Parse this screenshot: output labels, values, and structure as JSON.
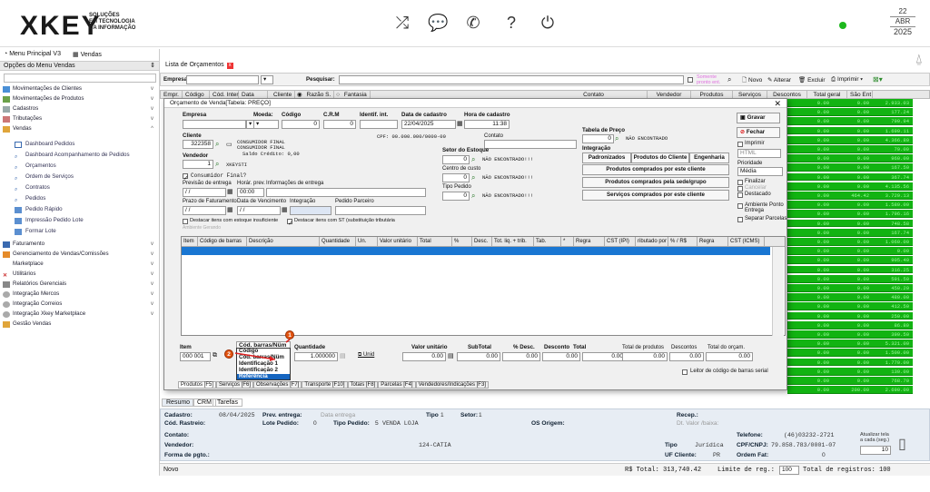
{
  "header": {
    "logo_text": "XKEY",
    "logo_sub": [
      "SOLUÇÕES",
      "EM TECNOLOGIA",
      "DA INFORMAÇÃO"
    ],
    "date_day": "22",
    "date_month": "ABR",
    "date_year": "2025"
  },
  "top_tabs": [
    "Menu Principal V3",
    "Vendas"
  ],
  "sidebar": {
    "title": "Opções do Menu Vendas",
    "items": [
      {
        "label": "Movimentações de Clientes",
        "chevron": "v"
      },
      {
        "label": "Movimentações de Produtos",
        "chevron": "v"
      },
      {
        "label": "Cadastros",
        "chevron": "v"
      },
      {
        "label": "Tributações",
        "chevron": "v"
      },
      {
        "label": "Vendas",
        "chevron": "^"
      }
    ],
    "sub_items": [
      "Dashboard Pedidos",
      "Dashboard Acompanhamento de Pedidos",
      "Orçamentos",
      "Ordem de Serviços",
      "Contratos",
      "Pedidos",
      "Pedido Rápido",
      "Impressão Pedido Lote",
      "Formar Lote"
    ],
    "items2": [
      "Faturamento",
      "Gerenciamento de Vendas/Comissões",
      "Marketplace",
      "Utilitários",
      "Relatórios Gerenciais",
      "Integração Mercos",
      "Integração Correios",
      "Integração Xkey Marketplace",
      "Gestão Vendas"
    ]
  },
  "main_tab": "Lista de Orçamentos",
  "toolbar": {
    "empresa_label": "Empresa",
    "pesquisar_label": "Pesquisar:",
    "somente_label": "Somente pronto ent.",
    "novo": "Novo",
    "alterar": "Alterar",
    "excluir": "Excluir",
    "imprimir": "Imprimir"
  },
  "grid_headers": [
    "Empr.",
    "Código",
    "Cód. Inter",
    "Data",
    "Cliente",
    "Razão S.",
    "Fantasia",
    "Contato",
    "Vendedor",
    "Produtos",
    "Serviços",
    "Descontos",
    "Total geral",
    "São Ent"
  ],
  "grid_values": [
    [
      "0.00",
      "0.00",
      "2.933.03"
    ],
    [
      "0.00",
      "0.00",
      "177.24"
    ],
    [
      "0.00",
      "0.00",
      "799.94"
    ],
    [
      "0.00",
      "0.00",
      "1.699.11"
    ],
    [
      "0.00",
      "0.00",
      "4.366.80"
    ],
    [
      "0.00",
      "0.00",
      "79.00"
    ],
    [
      "0.00",
      "0.00",
      "960.00"
    ],
    [
      "0.00",
      "0.00",
      "167.50"
    ],
    [
      "0.00",
      "0.00",
      "367.74"
    ],
    [
      "0.00",
      "0.00",
      "4.135.56"
    ],
    [
      "0.00",
      "464.42",
      "3.729.13"
    ],
    [
      "0.00",
      "0.00",
      "1.589.00"
    ],
    [
      "0.00",
      "0.00",
      "1.796.16"
    ],
    [
      "0.00",
      "0.00",
      "748.58"
    ],
    [
      "0.00",
      "0.00",
      "167.74"
    ],
    [
      "0.00",
      "0.00",
      "1.060.00"
    ],
    [
      "0.00",
      "0.00",
      "0.00"
    ],
    [
      "0.00",
      "0.00",
      "905.40"
    ],
    [
      "0.00",
      "0.00",
      "316.25"
    ],
    [
      "0.00",
      "0.00",
      "591.50"
    ],
    [
      "0.00",
      "0.00",
      "450.20"
    ],
    [
      "0.00",
      "0.00",
      "480.00"
    ],
    [
      "0.00",
      "0.00",
      "412.50"
    ],
    [
      "0.00",
      "0.00",
      "250.00"
    ],
    [
      "0.00",
      "0.00",
      "86.80"
    ],
    [
      "0.00",
      "0.00",
      "399.50"
    ],
    [
      "0.00",
      "0.00",
      "5.321.00"
    ],
    [
      "0.00",
      "0.00",
      "1.500.00"
    ],
    [
      "0.00",
      "0.00",
      "1.770.00"
    ],
    [
      "0.00",
      "0.00",
      "130.00"
    ],
    [
      "0.00",
      "0.00",
      "768.70"
    ],
    [
      "0.00",
      "200.00",
      "2.690.00"
    ]
  ],
  "dialog": {
    "title": "Orçamento de Venda[Tabela: PREÇO]",
    "empresa": "Empresa",
    "moeda": "Moeda:",
    "codigo": "Código",
    "crm": "C.R.M",
    "identif": "Identif. int.",
    "data_cadastro_label": "Data de cadastro",
    "hora_cadastro_label": "Hora de cadastro",
    "codigo_val": "0",
    "crm_val": "0",
    "data_cadastro": "22/04/2025",
    "hora_cadastro": "11:38",
    "cliente_label": "Cliente",
    "cliente_code": "322358",
    "cliente_name1": "CONSUMIDOR FINAL",
    "cliente_name2": "CONSUMIDOR FINAL",
    "saldo": "Saldo Crédito: 0,00",
    "cpf": "CPF: 00.000.000/0000-00",
    "contato_label": "Contato",
    "vendedor_label": "Vendedor",
    "vendedor_code": "1",
    "vendedor_name": "XKEYSTI",
    "consumidor_final": "Consumidor Final?",
    "previsao": "Previsão de entrega",
    "horar": "Horár. prev.",
    "info_entrega": "Informações de entrega",
    "previsao_val": "/ /",
    "horar_val": "00:00",
    "prazo": "Prazo de Faturamento",
    "data_venc": "Data de Vencimento",
    "integracao_lbl": "Integração",
    "pedido_parceiro": "Pedido Parceiro",
    "prazo_val": "/ /",
    "venc_val": "/ /",
    "destacar1": "Destacar itens com estoque insuficiente",
    "destacar2": "Destacar itens com ST (substituição tributária",
    "ambiente": "Ambiente Gerando",
    "setor": "Setor do Estoque",
    "setor_val": "0",
    "nao_enc": "NÃO ENCONTRADO!!!",
    "centro": "Centro de custo",
    "centro_val": "0",
    "tipo_pedido": "Tipo Pedido",
    "tipo_val": "0",
    "tabela_preco": "Tabela de Preço",
    "tabela_val": "0",
    "nao_enc2": "NÃO ENCONTRADO",
    "integracao": "Integração",
    "btn_padronizados": "Padronizados",
    "btn_produtos_cliente": "Produtos do Cliente",
    "btn_engenharia": "Engenharia",
    "btn_comprados_cliente": "Produtos comprados por este cliente",
    "btn_comprados_sede": "Produtos comprados pela sede/grupo",
    "btn_servicos": "Serviços comprados por este cliente",
    "gravar": "Gravar",
    "fechar": "Fechar",
    "imprimir": "Imprimir",
    "html": "HTML",
    "prioridade": "Prioridade",
    "prioridade_val": "Média",
    "finalizar": "Finalizar",
    "cancelar": "Cancelar",
    "destacado": "Destacado",
    "amb_ponto": "Ambiente Ponto Entrega",
    "separar": "Separar Parcelas",
    "item_headers": [
      "Item",
      "Código de barras",
      "Descrição",
      "Quantidade",
      "Un.",
      "Valor unitário",
      "Total",
      "%",
      "Desc.",
      "Tot. liq. + trib.",
      "Tab.",
      "*",
      "Regra",
      "CST (IPI)",
      "ributado por",
      "% / R$",
      "Regra",
      "CST (ICMS)"
    ],
    "item_label": "Item",
    "item_val": "000 001",
    "combo_val": "Cód. barras/Nüm",
    "quantidade_label": "Quantidade",
    "quantidade_val": "1.000000",
    "unid": "Unid",
    "valor_unit_label": "Valor unitário",
    "valor_unit_val": "0.00",
    "subtotal_label": "SubTotal",
    "subtotal_val": "0.00",
    "pdesc_label": "% Desc.",
    "pdesc_val": "0.00",
    "desconto_label": "Desconto",
    "desconto_val": "0.00",
    "total_label": "Total",
    "total_val": "0.00",
    "total_prod_label": "Total de produtos",
    "total_prod_val": "0.00",
    "descontos_label": "Descontos",
    "descontos_val": "0.00",
    "total_orc_label": "Total do orçam.",
    "total_orc_val": "0.00",
    "leitor": "Leitor de código de barras serial",
    "dropdown": [
      "Código",
      "Cód. barras/Nüm",
      "Identificação 1",
      "Identificação 2",
      "Referência"
    ],
    "badges": [
      "1",
      "2"
    ],
    "bottom_tabs": [
      "Produtos [F5]",
      "Serviços [F6]",
      "Observações [F7]",
      "Transporte [F10]",
      "Totais [F8]",
      "Parcelas [F4]",
      "Vendedores/Indicações [F3]"
    ]
  },
  "lower_tabs": [
    "Resumo",
    "CRM",
    "Tarefas"
  ],
  "info": {
    "cadastro_l": "Cadastro:",
    "cadastro_v": "08/04/2025",
    "prev_entrega_l": "Prev. entrega:",
    "data_entrega_v": "Data entrega",
    "tipo_l": "Tipo",
    "tipo_v": "1",
    "setor_l": "Setor:",
    "setor_v": "1",
    "recep_l": "Recep.:",
    "cod_rastreio_l": "Cód. Rastreio:",
    "lote_l": "Lote Pedido:",
    "lote_v": "0",
    "tipo_pedido_l": "Tipo Pedido:",
    "tipo_pedido_v": "5",
    "tipo_pedido_n": "VENDA LOJA",
    "os_origem_l": "OS Origem:",
    "dt_valor_baixa": "Dt. Valor /baixa:",
    "contato_l": "Contato:",
    "vendedor_l": "Vendedor:",
    "vendedor_v": "124-CATIA",
    "forma_pgto_l": "Forma de pgto.:",
    "telefone_l": "Telefone:",
    "telefone_v": "(46)03232-2721",
    "cpf_l": "CPF/CNPJ:",
    "cpf_v": "79.858.783/0001-07",
    "tipo2_l": "Tipo",
    "tipo2_v": "Jurídica",
    "uf_l": "UF Cliente:",
    "uf_v": "PR",
    "ordem_l": "Ordem Fat:",
    "ordem_v": "0",
    "atualizar_l": "Atualizar tela a cada (seg.)",
    "atualizar_v": "10"
  },
  "status": {
    "novo": "Novo",
    "total": "R$ Total: 313,740.42",
    "limite_l": "Limite de reg.:",
    "limite_v": "100",
    "registros": "Total de registros: 100"
  }
}
